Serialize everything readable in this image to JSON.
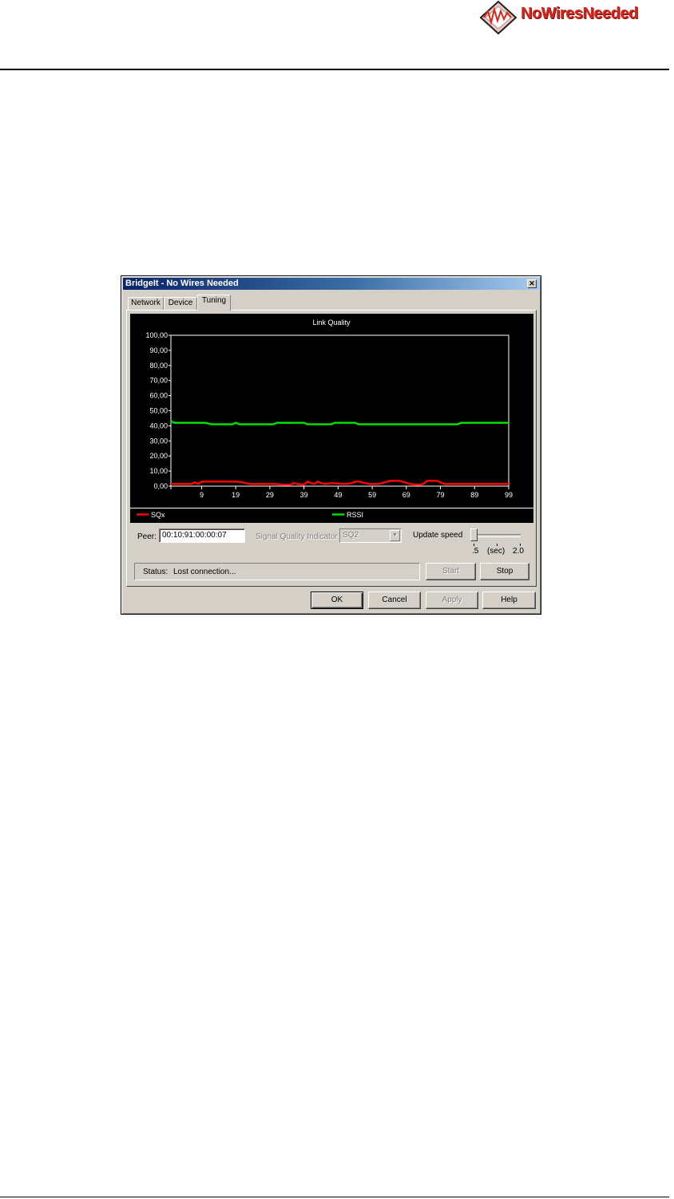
{
  "logo": {
    "text": "NoWiresNeeded",
    "icon": "company-logo-icon"
  },
  "dialog": {
    "title": "BridgeIt - No Wires Needed",
    "close_label": "✕",
    "tabs": [
      {
        "label": "Network"
      },
      {
        "label": "Device"
      },
      {
        "label": "Tuning"
      }
    ],
    "active_tab": "Tuning",
    "peer": {
      "label": "Peer:",
      "value": "00:10:91:00:00:07"
    },
    "signal_quality": {
      "label": "Signal Quality Indicator",
      "selected": "SQ2"
    },
    "update_speed": {
      "label": "Update speed",
      "min_label": ".5",
      "unit_label": "(sec)",
      "max_label": "2.0",
      "value": 0.5
    },
    "status": {
      "label": "Status:",
      "text": "Lost connection..."
    },
    "buttons": {
      "start": "Start",
      "stop": "Stop",
      "ok": "OK",
      "cancel": "Cancel",
      "apply": "Apply",
      "help": "Help"
    }
  },
  "colors": {
    "sqx": "#ff0000",
    "rssi": "#00dd00",
    "title_bar": "#0a246a",
    "dialog_bg": "#d4d0c8"
  },
  "chart_data": {
    "type": "line",
    "title": "Link Quality",
    "ylim": [
      0,
      100
    ],
    "y_ticks": [
      "0,00",
      "10,00",
      "20,00",
      "30,00",
      "40,00",
      "50,00",
      "60,00",
      "70,00",
      "80,00",
      "90,00",
      "100,00"
    ],
    "x_tick_labels": [
      "9",
      "19",
      "29",
      "39",
      "49",
      "59",
      "69",
      "79",
      "89",
      "99"
    ],
    "x_tick_values": [
      9,
      19,
      29,
      39,
      49,
      59,
      69,
      79,
      89,
      99
    ],
    "xlim": [
      0,
      99
    ],
    "grid": false,
    "legend_position": "bottom",
    "series": [
      {
        "name": "SQx",
        "color": "#ff0000",
        "points": [
          [
            0,
            1.5
          ],
          [
            6,
            1.5
          ],
          [
            7,
            2.5
          ],
          [
            8,
            1.5
          ],
          [
            9,
            3
          ],
          [
            10,
            3
          ],
          [
            19,
            3
          ],
          [
            21,
            2.5
          ],
          [
            23,
            1.5
          ],
          [
            30,
            1.5
          ],
          [
            33,
            1
          ],
          [
            35,
            1
          ],
          [
            36,
            2
          ],
          [
            37,
            1.5
          ],
          [
            39,
            1
          ],
          [
            40,
            3
          ],
          [
            41,
            2
          ],
          [
            42,
            1.5
          ],
          [
            43,
            3
          ],
          [
            44,
            2
          ],
          [
            45,
            1.5
          ],
          [
            47,
            2
          ],
          [
            51,
            1.5
          ],
          [
            53,
            2
          ],
          [
            54,
            3
          ],
          [
            55,
            3
          ],
          [
            58,
            1.5
          ],
          [
            61,
            1.5
          ],
          [
            64,
            3.5
          ],
          [
            67,
            3.5
          ],
          [
            70,
            1.5
          ],
          [
            72,
            1
          ],
          [
            73,
            1
          ],
          [
            74,
            1.5
          ],
          [
            75,
            3.5
          ],
          [
            78,
            3.5
          ],
          [
            80,
            1.5
          ],
          [
            99,
            1.5
          ]
        ]
      },
      {
        "name": "RSSI",
        "color": "#00dd00",
        "points": [
          [
            0,
            43
          ],
          [
            1,
            42
          ],
          [
            10,
            42
          ],
          [
            12,
            41
          ],
          [
            18,
            41
          ],
          [
            19,
            42
          ],
          [
            20,
            41
          ],
          [
            30,
            41
          ],
          [
            31,
            42
          ],
          [
            39,
            42
          ],
          [
            40,
            41
          ],
          [
            47,
            41
          ],
          [
            48,
            42
          ],
          [
            54,
            42
          ],
          [
            55,
            41
          ],
          [
            84,
            41
          ],
          [
            85,
            42
          ],
          [
            99,
            42
          ]
        ]
      }
    ]
  }
}
